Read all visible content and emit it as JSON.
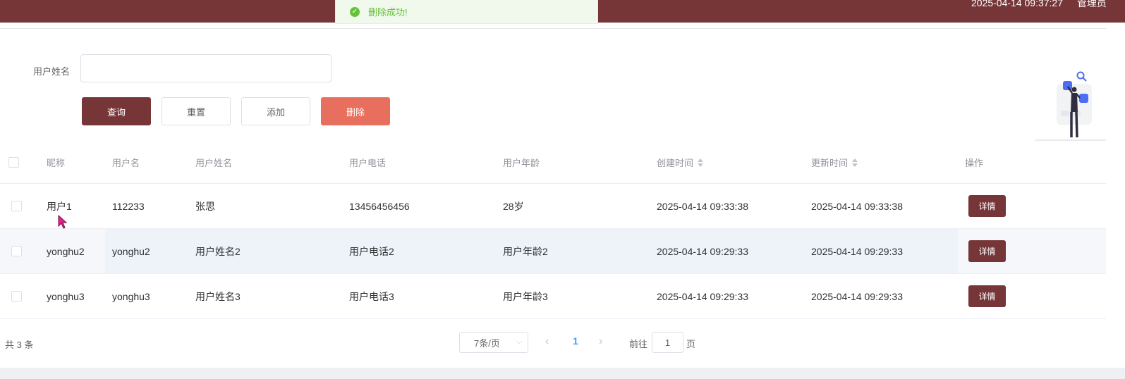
{
  "topbar": {
    "datetime": "2025-04-14 09:37:27",
    "user": "管理员"
  },
  "toast": {
    "message": "删除成功!",
    "icon": "check-circle-icon",
    "color": "#67c23a"
  },
  "search": {
    "label": "用户姓名",
    "value": "",
    "placeholder": ""
  },
  "buttons": {
    "query": "查询",
    "reset": "重置",
    "add": "添加",
    "delete": "删除"
  },
  "table": {
    "columns": [
      "昵称",
      "用户名",
      "用户姓名",
      "用户电话",
      "用户年龄",
      "创建时间",
      "更新时间",
      "操作"
    ],
    "rows": [
      {
        "nickname": "用户1",
        "username": "112233",
        "realname": "张思",
        "phone": "13456456456",
        "age": "28岁",
        "created": "2025-04-14 09:33:38",
        "updated": "2025-04-14 09:33:38",
        "action": "详情"
      },
      {
        "nickname": "yonghu2",
        "username": "yonghu2",
        "realname": "用户姓名2",
        "phone": "用户电话2",
        "age": "用户年龄2",
        "created": "2025-04-14 09:29:33",
        "updated": "2025-04-14 09:29:33",
        "action": "详情"
      },
      {
        "nickname": "yonghu3",
        "username": "yonghu3",
        "realname": "用户姓名3",
        "phone": "用户电话3",
        "age": "用户年龄3",
        "created": "2025-04-14 09:29:33",
        "updated": "2025-04-14 09:29:33",
        "action": "详情"
      }
    ]
  },
  "pagination": {
    "total": "共 3 条",
    "page_size": "7条/页",
    "current_page": "1",
    "goto_label": "前往",
    "goto_value": "1",
    "goto_suffix": "页"
  },
  "colors": {
    "primary": "#763537",
    "danger": "#e86f5e",
    "success": "#67c23a",
    "link": "#409eff"
  }
}
